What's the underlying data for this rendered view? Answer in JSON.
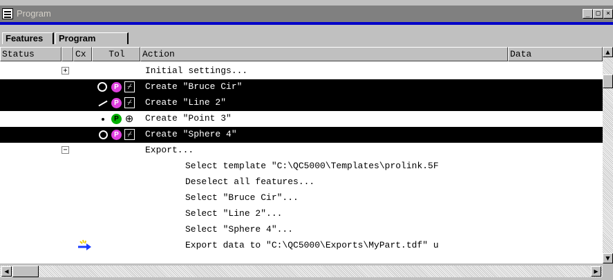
{
  "window": {
    "title": "Program",
    "minimize_glyph": "_",
    "maximize_glyph": "□",
    "close_glyph": "×"
  },
  "tabs": [
    {
      "label": "Features"
    },
    {
      "label": "Program"
    }
  ],
  "columns": [
    "Status",
    "Cx",
    "Tol",
    "Action",
    "Data"
  ],
  "rows": [
    {
      "expander": "+",
      "action": "Initial settings...",
      "selected": false
    },
    {
      "shape": "circle-icon",
      "badge": "P",
      "tol": "⌿",
      "action": "Create \"Bruce Cir\"",
      "selected": true
    },
    {
      "shape": "line-icon",
      "badge": "P",
      "tol": "⌿",
      "action": "Create \"Line 2\"",
      "selected": true
    },
    {
      "shape": "point-icon",
      "badge": "P",
      "tol": "⊕",
      "action": "Create \"Point 3\"",
      "selected": false
    },
    {
      "shape": "sphere-icon",
      "badge": "P",
      "tol": "⌿",
      "action": "Create \"Sphere 4\"",
      "selected": true
    },
    {
      "expander": "−",
      "action": "Export...",
      "selected": false
    },
    {
      "action": "Select template \"C:\\QC5000\\Templates\\prolink.5F",
      "selected": false
    },
    {
      "action": "Deselect all features...",
      "selected": false
    },
    {
      "action": "Select \"Bruce Cir\"...",
      "selected": false
    },
    {
      "action": "Select \"Line 2\"...",
      "selected": false
    },
    {
      "action": "Select \"Sphere 4\"...",
      "selected": false
    },
    {
      "arrow": "current-step-arrow-icon",
      "action": "Export data to \"C:\\QC5000\\Exports\\MyPart.tdf\" u",
      "selected": false
    }
  ],
  "scroll": {
    "up_glyph": "▲",
    "down_glyph": "▼",
    "left_glyph": "◀",
    "right_glyph": "▶"
  },
  "colors": {
    "selected_row": "#000000",
    "badge_p": "#e040e0",
    "badge_point": "#00b000",
    "title_accent": "#0000c8",
    "arrow": "#1a3cff",
    "arrow_spark": "#f0d000"
  }
}
